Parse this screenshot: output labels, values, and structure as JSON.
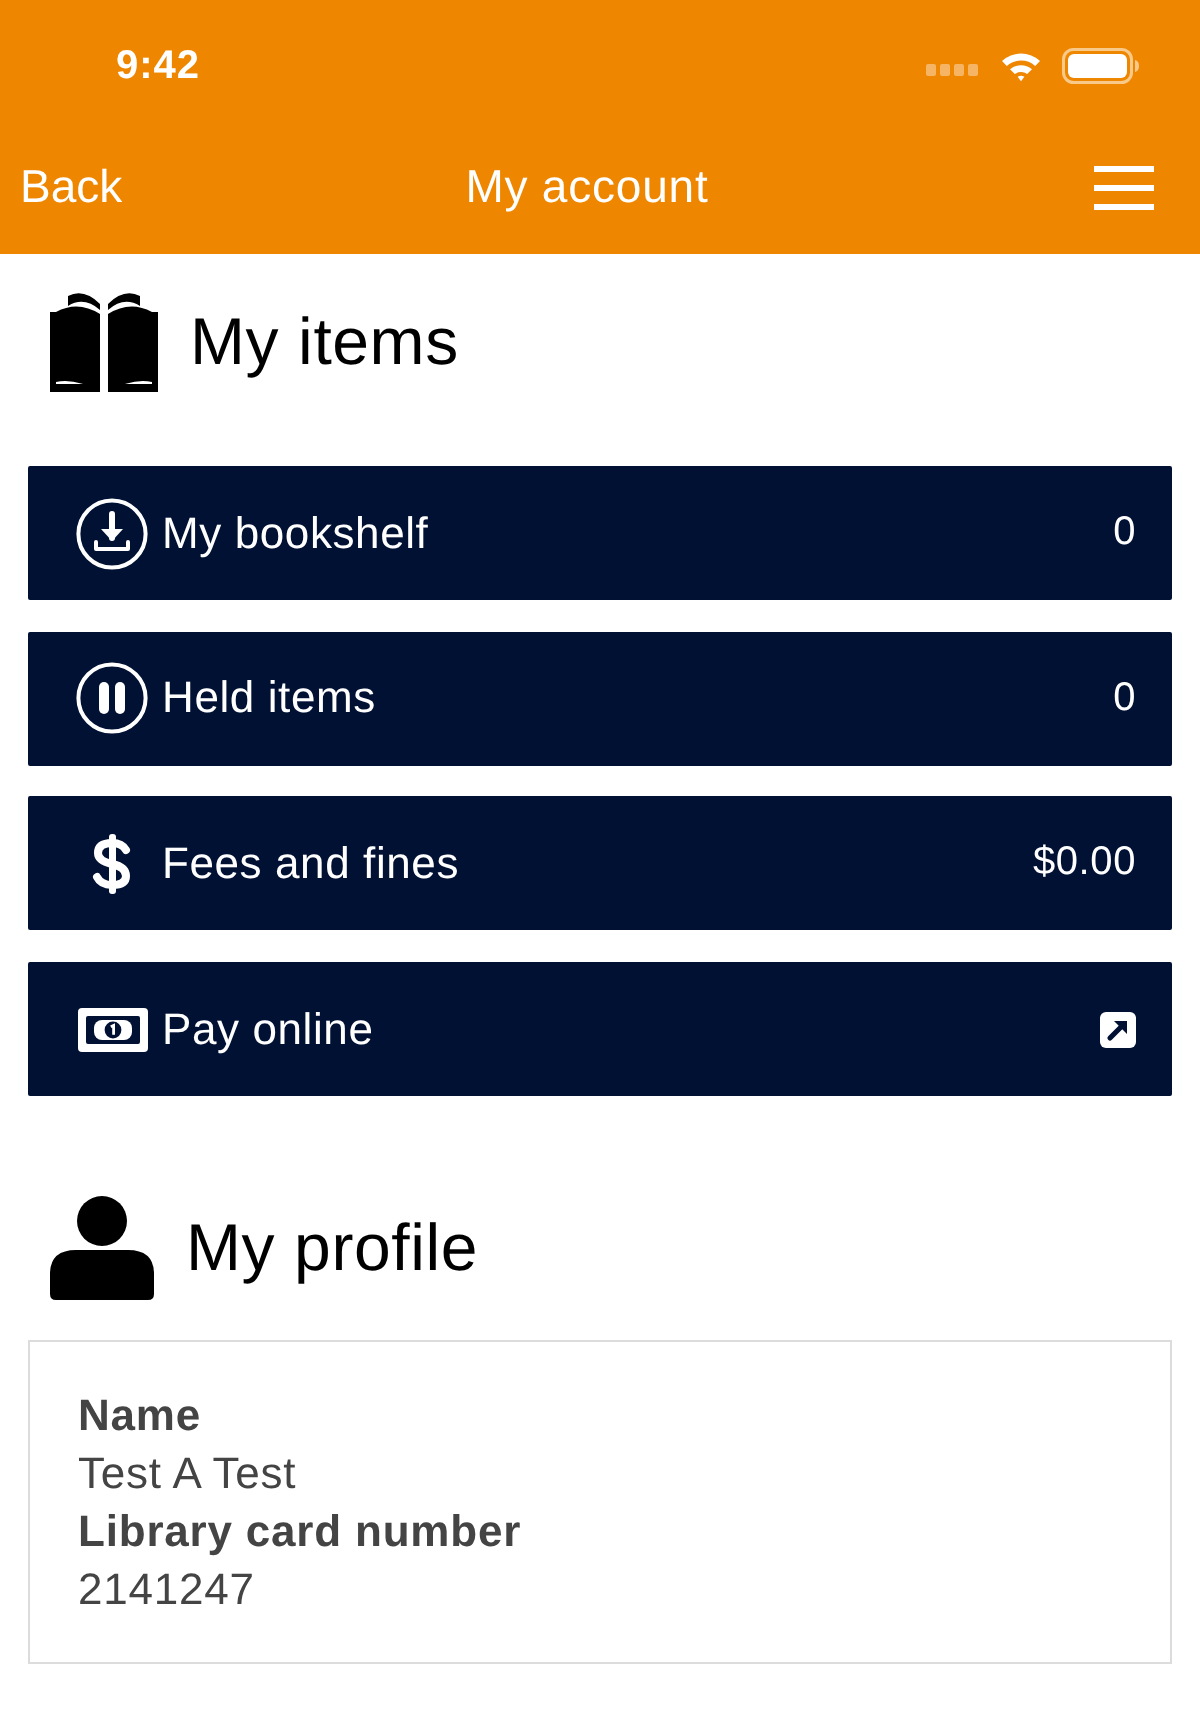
{
  "status_bar": {
    "time": "9:42"
  },
  "nav_bar": {
    "back": "Back",
    "title": "My account"
  },
  "items_section": {
    "title": "My items",
    "rows": [
      {
        "label": "My bookshelf",
        "kind": "value",
        "value": "0"
      },
      {
        "label": "Held items",
        "kind": "value",
        "value": "0"
      },
      {
        "label": "Fees and fines",
        "kind": "value",
        "value": "$0.00"
      },
      {
        "label": "Pay online",
        "kind": "link"
      }
    ]
  },
  "profile_section": {
    "title": "My profile",
    "fields": [
      {
        "label": "Name",
        "value": "Test A Test"
      },
      {
        "label": "Library card number",
        "value": "2141247"
      }
    ]
  }
}
